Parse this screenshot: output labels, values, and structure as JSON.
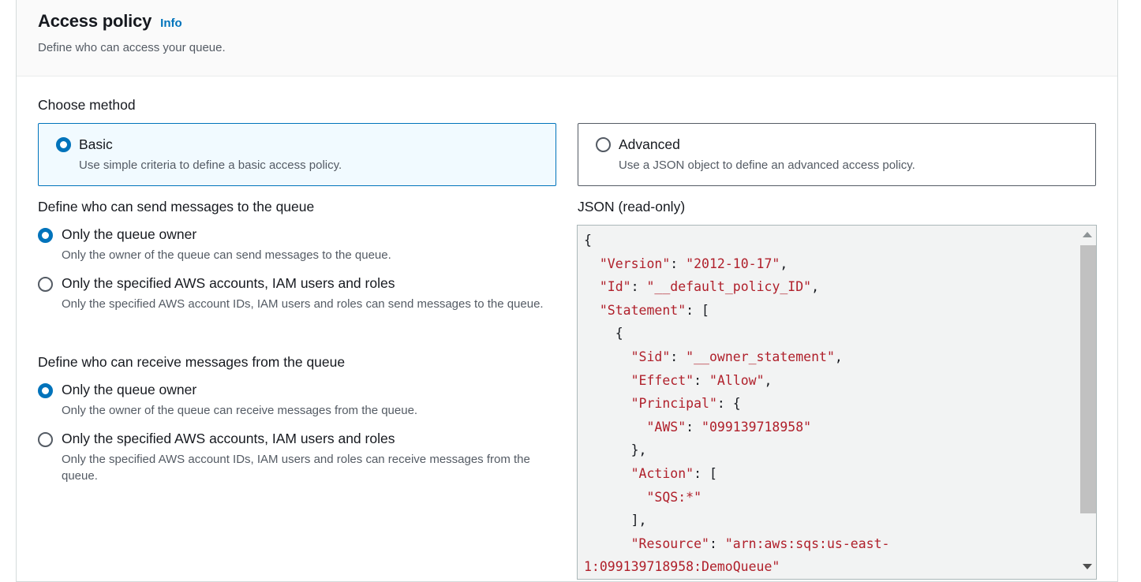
{
  "header": {
    "title": "Access policy",
    "info_link": "Info",
    "subtitle": "Define who can access your queue."
  },
  "method": {
    "label": "Choose method",
    "options": [
      {
        "label": "Basic",
        "description": "Use simple criteria to define a basic access policy.",
        "selected": true
      },
      {
        "label": "Advanced",
        "description": "Use a JSON object to define an advanced access policy.",
        "selected": false
      }
    ]
  },
  "send": {
    "label": "Define who can send messages to the queue",
    "options": [
      {
        "label": "Only the queue owner",
        "description": "Only the owner of the queue can send messages to the queue.",
        "selected": true
      },
      {
        "label": "Only the specified AWS accounts, IAM users and roles",
        "description": "Only the specified AWS account IDs, IAM users and roles can send messages to the queue.",
        "selected": false
      }
    ]
  },
  "receive": {
    "label": "Define who can receive messages from the queue",
    "options": [
      {
        "label": "Only the queue owner",
        "description": "Only the owner of the queue can receive messages from the queue.",
        "selected": true
      },
      {
        "label": "Only the specified AWS accounts, IAM users and roles",
        "description": "Only the specified AWS account IDs, IAM users and roles can receive messages from the queue.",
        "selected": false
      }
    ]
  },
  "json": {
    "label": "JSON (read-only)",
    "lines": [
      [
        {
          "t": "p",
          "v": "{"
        }
      ],
      [
        {
          "t": "p",
          "v": "  "
        },
        {
          "t": "k",
          "v": "\"Version\""
        },
        {
          "t": "p",
          "v": ": "
        },
        {
          "t": "s",
          "v": "\"2012-10-17\""
        },
        {
          "t": "p",
          "v": ","
        }
      ],
      [
        {
          "t": "p",
          "v": "  "
        },
        {
          "t": "k",
          "v": "\"Id\""
        },
        {
          "t": "p",
          "v": ": "
        },
        {
          "t": "s",
          "v": "\"__default_policy_ID\""
        },
        {
          "t": "p",
          "v": ","
        }
      ],
      [
        {
          "t": "p",
          "v": "  "
        },
        {
          "t": "k",
          "v": "\"Statement\""
        },
        {
          "t": "p",
          "v": ": ["
        }
      ],
      [
        {
          "t": "p",
          "v": "    {"
        }
      ],
      [
        {
          "t": "p",
          "v": "      "
        },
        {
          "t": "k",
          "v": "\"Sid\""
        },
        {
          "t": "p",
          "v": ": "
        },
        {
          "t": "s",
          "v": "\"__owner_statement\""
        },
        {
          "t": "p",
          "v": ","
        }
      ],
      [
        {
          "t": "p",
          "v": "      "
        },
        {
          "t": "k",
          "v": "\"Effect\""
        },
        {
          "t": "p",
          "v": ": "
        },
        {
          "t": "s",
          "v": "\"Allow\""
        },
        {
          "t": "p",
          "v": ","
        }
      ],
      [
        {
          "t": "p",
          "v": "      "
        },
        {
          "t": "k",
          "v": "\"Principal\""
        },
        {
          "t": "p",
          "v": ": {"
        }
      ],
      [
        {
          "t": "p",
          "v": "        "
        },
        {
          "t": "k",
          "v": "\"AWS\""
        },
        {
          "t": "p",
          "v": ": "
        },
        {
          "t": "s",
          "v": "\"099139718958\""
        }
      ],
      [
        {
          "t": "p",
          "v": "      },"
        }
      ],
      [
        {
          "t": "p",
          "v": "      "
        },
        {
          "t": "k",
          "v": "\"Action\""
        },
        {
          "t": "p",
          "v": ": ["
        }
      ],
      [
        {
          "t": "p",
          "v": "        "
        },
        {
          "t": "s",
          "v": "\"SQS:*\""
        }
      ],
      [
        {
          "t": "p",
          "v": "      ],"
        }
      ],
      [
        {
          "t": "p",
          "v": "      "
        },
        {
          "t": "k",
          "v": "\"Resource\""
        },
        {
          "t": "p",
          "v": ": "
        },
        {
          "t": "s",
          "v": "\"arn:aws:sqs:us-east-"
        }
      ],
      [
        {
          "t": "s",
          "v": "1:099139718958:DemoQueue\""
        }
      ]
    ]
  }
}
